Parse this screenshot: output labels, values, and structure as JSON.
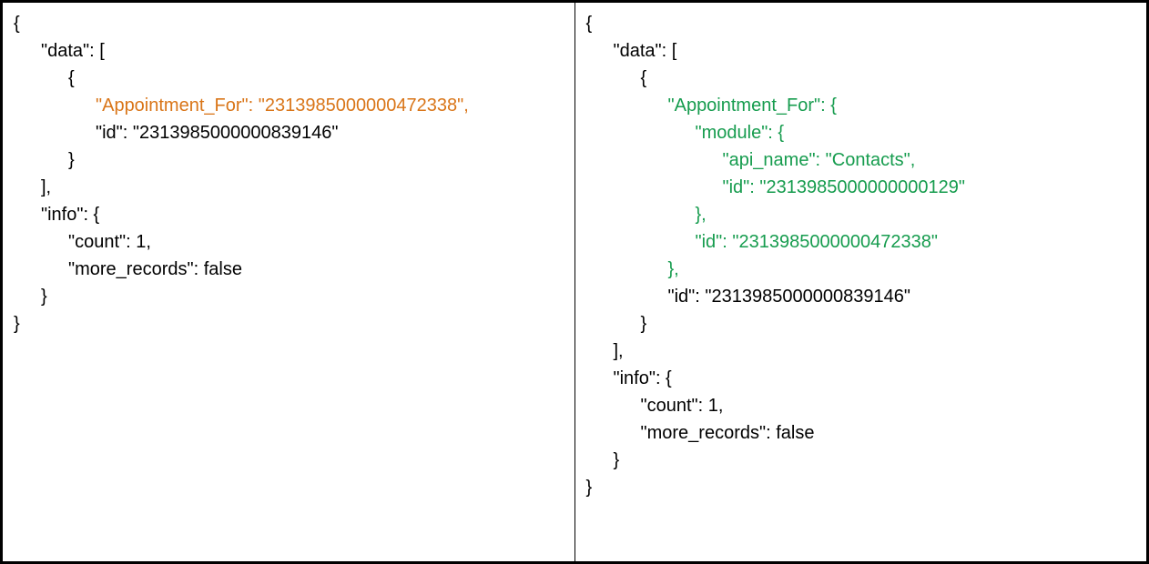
{
  "left": {
    "l1": "{",
    "l2": "\"data\": [",
    "l3": "{",
    "l4": "\"Appointment_For\": \"2313985000000472338\",",
    "l5": "\"id\": \"2313985000000839146\"",
    "l6": "}",
    "l7": "],",
    "l8": "\"info\": {",
    "l9": "\"count\": 1,",
    "l10": "\"more_records\": false",
    "l11": "}",
    "l12": "}"
  },
  "right": {
    "r1": "{",
    "r2": "\"data\": [",
    "r3": "{",
    "r4": "\"Appointment_For\": {",
    "r5": "\"module\": {",
    "r6": "\"api_name\": \"Contacts\",",
    "r7": "\"id\": \"2313985000000000129\"",
    "r8": "},",
    "r9": "\"id\": \"2313985000000472338\"",
    "r10": "},",
    "r11": "\"id\": \"2313985000000839146\"",
    "r12": "}",
    "r13": "],",
    "r14": "\"info\": {",
    "r15": "\"count\": 1,",
    "r16": "\"more_records\": false",
    "r17": "}",
    "r18": "}"
  }
}
